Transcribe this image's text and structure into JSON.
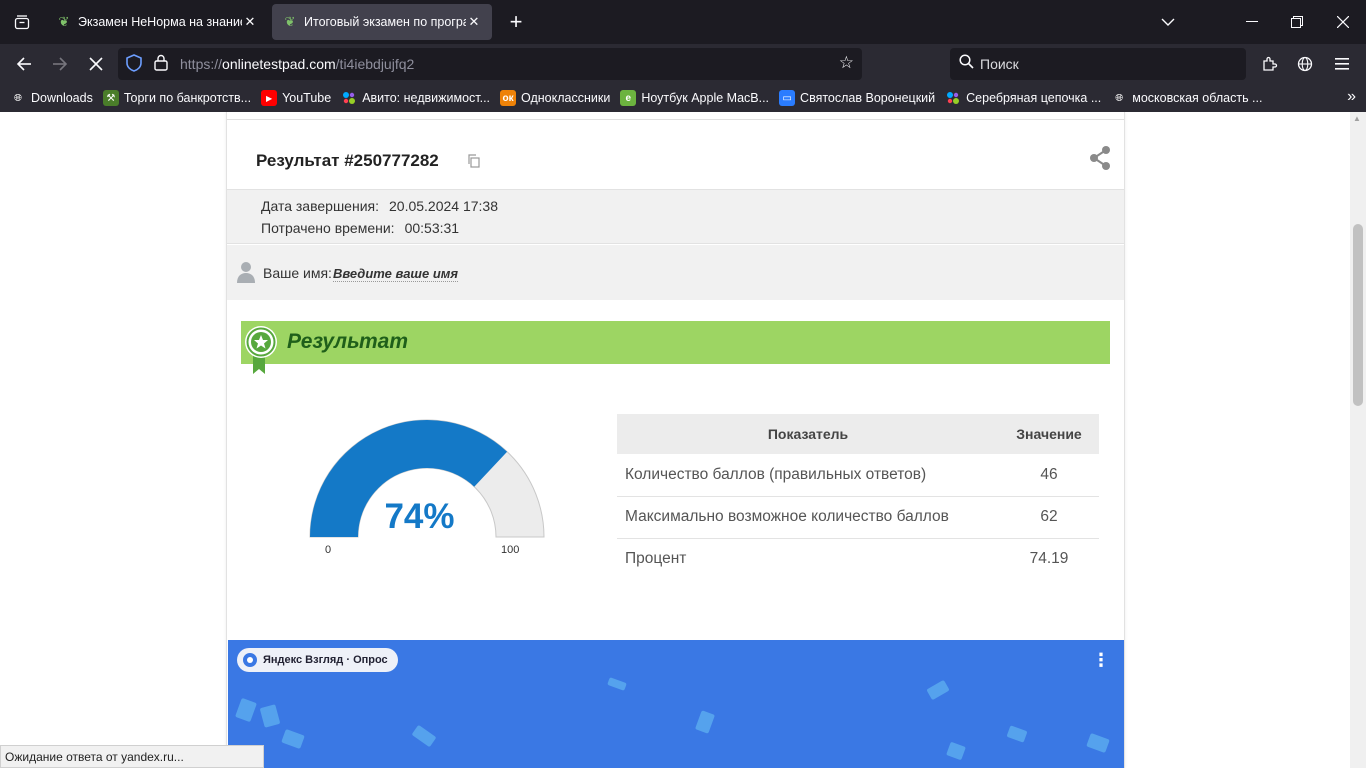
{
  "browser": {
    "tabs": [
      {
        "title": "Экзамен НеНорма на знание г",
        "active": false
      },
      {
        "title": "Итоговый экзамен по програ",
        "active": true
      }
    ],
    "url_prefix": "https://",
    "url_host": "onlinetestpad.com",
    "url_path": "/ti4iebdjujfq2",
    "search_placeholder": "Поиск",
    "bookmarks": [
      {
        "label": "Downloads",
        "icon": "globe-icon",
        "color": "#2b2a33"
      },
      {
        "label": "Торги по банкротств...",
        "icon": "hammer-icon",
        "color": "#4a7d2a"
      },
      {
        "label": "YouTube",
        "icon": "youtube-icon",
        "color": "#ff0000"
      },
      {
        "label": "Авито: недвижимост...",
        "icon": "avito-icon",
        "color": "#00aaff"
      },
      {
        "label": "Одноклассники",
        "icon": "ok-icon",
        "color": "#ee8208"
      },
      {
        "label": "Ноутбук Apple MacB...",
        "icon": "store-icon",
        "color": "#6cb33f"
      },
      {
        "label": "Святослав Воронецкий",
        "icon": "chat-icon",
        "color": "#2a7cff"
      },
      {
        "label": "Серебряная цепочка ...",
        "icon": "avito-icon",
        "color": "#00aaff"
      },
      {
        "label": "московская область ...",
        "icon": "globe-icon",
        "color": "#2b2a33"
      }
    ]
  },
  "result": {
    "title": "Результат #250777282",
    "completed_label": "Дата завершения:",
    "completed_value": "20.05.2024 17:38",
    "time_label": "Потрачено времени:",
    "time_value": "00:53:31",
    "name_label": "Ваше имя:",
    "name_placeholder": "Введите ваше имя",
    "section_title": "Результат",
    "gauge": {
      "percent_text": "74%",
      "value": 74,
      "min": "0",
      "max": "100"
    },
    "table": {
      "headers": [
        "Показатель",
        "Значение"
      ],
      "rows": [
        [
          "Количество баллов (правильных ответов)",
          "46"
        ],
        [
          "Максимально возможное количество баллов",
          "62"
        ],
        [
          "Процент",
          "74.19"
        ]
      ]
    }
  },
  "ad": {
    "label": "Яндекс Взгляд · Опрос"
  },
  "status_text": "Ожидание ответа от yandex.ru...",
  "colors": {
    "gauge_fill": "#1479c7",
    "gauge_track": "#ececec",
    "banner": "#9dd563",
    "ad_bg": "#3a78e4"
  }
}
